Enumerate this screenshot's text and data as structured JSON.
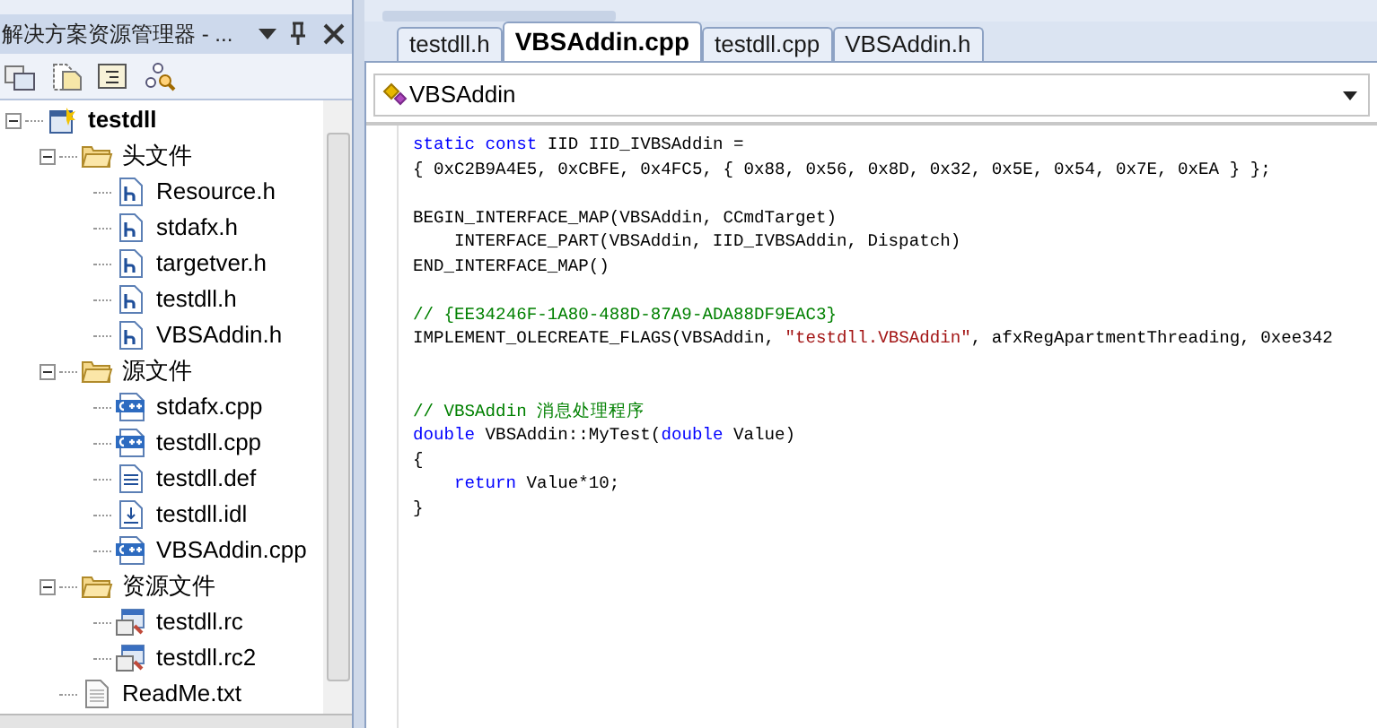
{
  "explorer": {
    "title": "解决方案资源管理器 - ...",
    "tree": [
      {
        "label": "testdll",
        "kind": "project",
        "expanded": true,
        "children": [
          {
            "label": "头文件",
            "kind": "folder",
            "expanded": true,
            "children": [
              {
                "label": "Resource.h",
                "kind": "header"
              },
              {
                "label": "stdafx.h",
                "kind": "header"
              },
              {
                "label": "targetver.h",
                "kind": "header"
              },
              {
                "label": "testdll.h",
                "kind": "header"
              },
              {
                "label": "VBSAddin.h",
                "kind": "header"
              }
            ]
          },
          {
            "label": "源文件",
            "kind": "folder",
            "expanded": true,
            "children": [
              {
                "label": "stdafx.cpp",
                "kind": "cpp"
              },
              {
                "label": "testdll.cpp",
                "kind": "cpp"
              },
              {
                "label": "testdll.def",
                "kind": "def"
              },
              {
                "label": "testdll.idl",
                "kind": "idl"
              },
              {
                "label": "VBSAddin.cpp",
                "kind": "cpp"
              }
            ]
          },
          {
            "label": "资源文件",
            "kind": "folder",
            "expanded": true,
            "children": [
              {
                "label": "testdll.rc",
                "kind": "rc"
              },
              {
                "label": "testdll.rc2",
                "kind": "rc"
              }
            ]
          },
          {
            "label": "ReadMe.txt",
            "kind": "txt"
          }
        ]
      }
    ]
  },
  "tabs": [
    {
      "label": "testdll.h",
      "selected": false
    },
    {
      "label": "VBSAddin.cpp",
      "selected": true
    },
    {
      "label": "testdll.cpp",
      "selected": false
    },
    {
      "label": "VBSAddin.h",
      "selected": false
    }
  ],
  "class_dropdown": {
    "value": "VBSAddin"
  },
  "code": [
    {
      "tokens": [
        {
          "kind": "keyword",
          "text": "static const "
        },
        {
          "kind": "plain",
          "text": "IID IID_IVBSAddin ="
        }
      ]
    },
    {
      "tokens": [
        {
          "kind": "plain",
          "text": "{ 0xC2B9A4E5, 0xCBFE, 0x4FC5, { 0x88, 0x56, 0x8D, 0x32, 0x5E, 0x54, 0x7E, 0xEA } };"
        }
      ]
    },
    {
      "kind": "blank"
    },
    {
      "tokens": [
        {
          "kind": "plain",
          "text": "BEGIN_INTERFACE_MAP(VBSAddin, CCmdTarget)"
        }
      ]
    },
    {
      "indent": true,
      "tokens": [
        {
          "kind": "plain",
          "text": "INTERFACE_PART(VBSAddin, IID_IVBSAddin, Dispatch)"
        }
      ]
    },
    {
      "tokens": [
        {
          "kind": "plain",
          "text": "END_INTERFACE_MAP()"
        }
      ]
    },
    {
      "kind": "blank"
    },
    {
      "tokens": [
        {
          "kind": "comment",
          "text": "// {EE34246F-1A80-488D-87A9-ADA88DF9EAC3}"
        }
      ]
    },
    {
      "tokens": [
        {
          "kind": "plain",
          "text": "IMPLEMENT_OLECREATE_FLAGS(VBSAddin, "
        },
        {
          "kind": "string",
          "text": "\"testdll.VBSAddin\""
        },
        {
          "kind": "plain",
          "text": ", afxRegApartmentThreading, 0xee342"
        }
      ]
    },
    {
      "kind": "blank"
    },
    {
      "kind": "blank"
    },
    {
      "tokens": [
        {
          "kind": "comment",
          "text": "// VBSAddin 消息处理程序"
        }
      ]
    },
    {
      "tokens": [
        {
          "kind": "keyword",
          "text": "double"
        },
        {
          "kind": "plain",
          "text": " VBSAddin::MyTest("
        },
        {
          "kind": "keyword",
          "text": "double"
        },
        {
          "kind": "plain",
          "text": " Value)"
        }
      ]
    },
    {
      "tokens": [
        {
          "kind": "plain",
          "text": "{"
        }
      ]
    },
    {
      "indent": true,
      "tokens": [
        {
          "kind": "keyword",
          "text": "return"
        },
        {
          "kind": "plain",
          "text": " Value*10;"
        }
      ]
    },
    {
      "tokens": [
        {
          "kind": "plain",
          "text": "}"
        }
      ]
    }
  ]
}
